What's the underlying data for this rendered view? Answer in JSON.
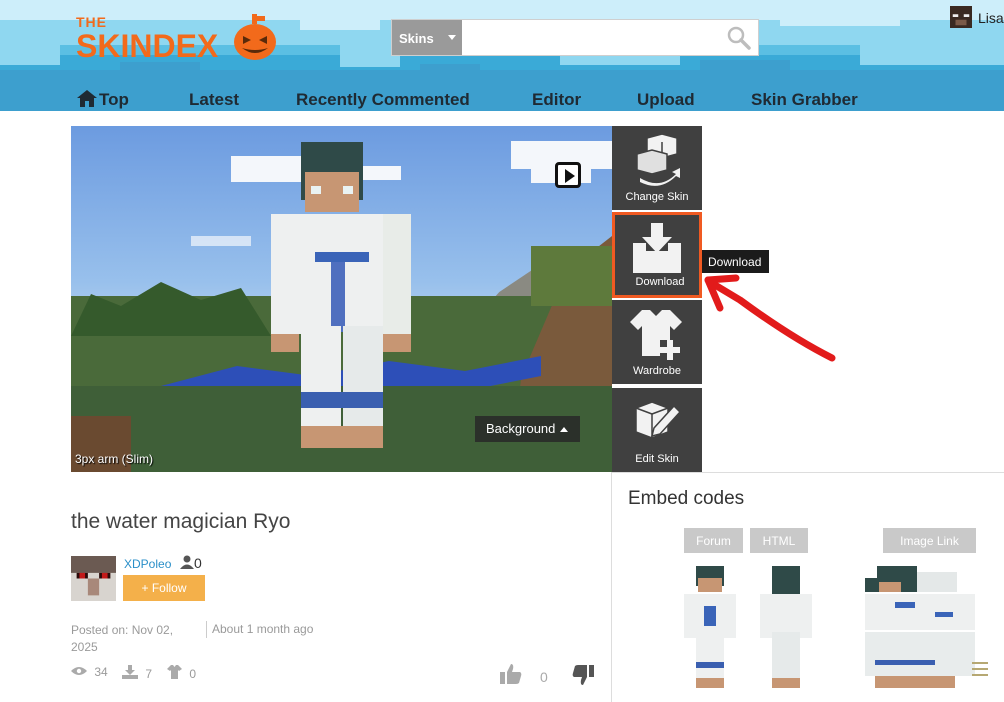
{
  "header": {
    "logo_the": "THE",
    "logo_main": "SKINDEX",
    "search": {
      "category": "Skins",
      "placeholder": ""
    },
    "user_name": "Lisa"
  },
  "nav": [
    {
      "label": "Top",
      "icon": "home-icon"
    },
    {
      "label": "Latest"
    },
    {
      "label": "Recently Commented"
    },
    {
      "label": "Editor"
    },
    {
      "label": "Upload"
    },
    {
      "label": "Skin Grabber"
    }
  ],
  "viewer": {
    "background_label": "Background",
    "arm_label": "3px arm (Slim)"
  },
  "tools": {
    "change_skin": "Change Skin",
    "download": "Download",
    "wardrobe": "Wardrobe",
    "edit_skin": "Edit Skin",
    "tooltip": "Download"
  },
  "skin": {
    "title": "the water magician Ryo",
    "author": "XDPoleo",
    "followers": "0",
    "follow_label": "+ Follow",
    "posted_on": "Posted on: Nov 02, 2025",
    "posted_ago": "About 1 month ago",
    "views": "34",
    "downloads": "7",
    "wardrobe_count": "0",
    "likes": "0"
  },
  "embed": {
    "title": "Embed codes",
    "forum": "Forum",
    "html": "HTML",
    "image_link": "Image Link"
  },
  "colors": {
    "brand_orange": "#f26a1b",
    "header_blue": "#5bbfe3",
    "tool_bg": "#404040",
    "download_border": "#f05a22",
    "follow_bg": "#f4b04a",
    "link_blue": "#2a8fc8",
    "annotation_red": "#e21b1b"
  }
}
